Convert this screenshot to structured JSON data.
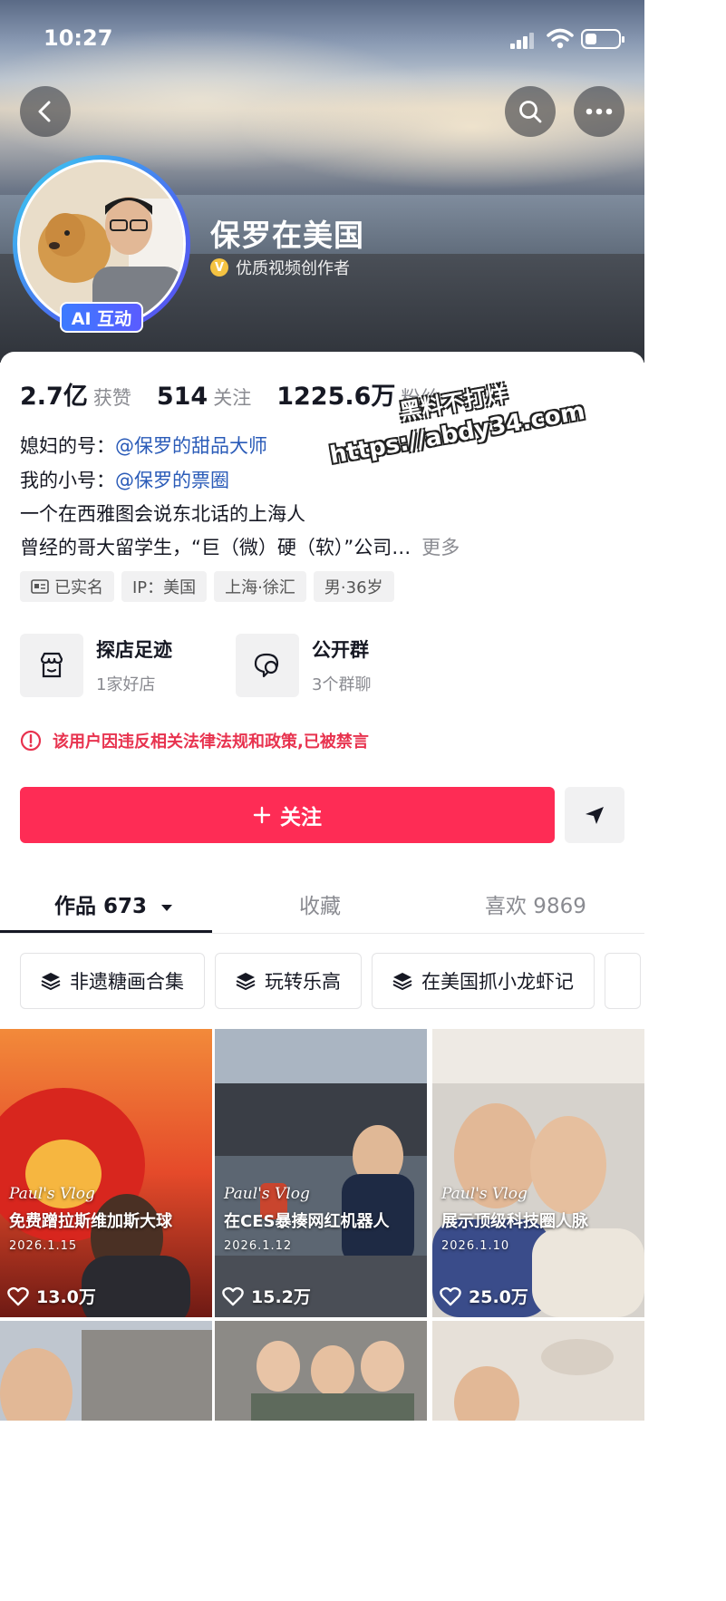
{
  "status_bar": {
    "time": "10:27"
  },
  "profile": {
    "nickname": "保罗在美国",
    "certification": "优质视频创作者",
    "ai_badge": "AI 互动"
  },
  "stats": [
    {
      "value": "2.7亿",
      "label": "获赞"
    },
    {
      "value": "514",
      "label": "关注"
    },
    {
      "value": "1225.6万",
      "label": "粉丝"
    }
  ],
  "bio": {
    "line1_prefix": "媳妇的号：",
    "line1_link": "@保罗的甜品大师",
    "line2_prefix": "我的小号：",
    "line2_link": "@保罗的票圈",
    "line3": "一个在西雅图会说东北话的上海人",
    "line4": "曾经的哥大留学生，“巨（微）硬（软）”公司…",
    "more": "更多"
  },
  "tags": [
    {
      "icon": "id-card-icon",
      "label": "已实名"
    },
    {
      "icon": "",
      "label": "IP：美国"
    },
    {
      "icon": "",
      "label": "上海·徐汇"
    },
    {
      "icon": "",
      "label": "男·36岁"
    }
  ],
  "features": [
    {
      "icon": "store-icon",
      "title": "探店足迹",
      "subtitle": "1家好店"
    },
    {
      "icon": "group-chat-icon",
      "title": "公开群",
      "subtitle": "3个群聊"
    }
  ],
  "warning": "该用户因违反相关法律法规和政策,已被禁言",
  "follow_button": "关注",
  "tabs": [
    {
      "label": "作品 673",
      "active": true
    },
    {
      "label": "收藏",
      "active": false
    },
    {
      "label": "喜欢 9869",
      "active": false
    }
  ],
  "collections": [
    "非遗糖画合集",
    "玩转乐高",
    "在美国抓小龙虾记"
  ],
  "videos": [
    {
      "vlog": "Paul's Vlog",
      "title": "免费蹭拉斯维加斯大球",
      "date": "2026.1.15",
      "likes": "13.0万"
    },
    {
      "vlog": "Paul's Vlog",
      "title": "在CES暴揍网红机器人",
      "date": "2026.1.12",
      "likes": "15.2万"
    },
    {
      "vlog": "Paul's Vlog",
      "title": "展示顶级科技圈人脉",
      "date": "2026.1.10",
      "likes": "25.0万"
    }
  ],
  "watermark": {
    "line1": "黑料不打烊",
    "line2": "https://abdy34.com"
  },
  "colors": {
    "accent": "#fe2c55",
    "link": "#2a5bb8",
    "warning": "#e8334f"
  }
}
